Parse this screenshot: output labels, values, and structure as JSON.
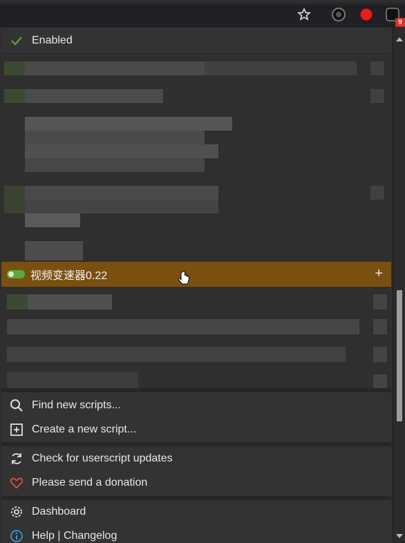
{
  "menu": {
    "enabled_label": "Enabled",
    "active_script": {
      "name": "视频变速器0.22",
      "add_label": "+"
    },
    "items": [
      {
        "label": "Find new scripts...",
        "icon": "search-icon"
      },
      {
        "label": "Create a new script...",
        "icon": "plus-square-icon"
      },
      {
        "label": "Check for userscript updates",
        "icon": "refresh-icon"
      },
      {
        "label": "Please send a donation",
        "icon": "heart-icon"
      },
      {
        "label": "Dashboard",
        "icon": "gear-icon"
      },
      {
        "label": "Help | Changelog",
        "icon": "info-icon"
      }
    ]
  },
  "toolbar": {
    "extension_badge": "9"
  },
  "colors": {
    "background": "#2f2f2f",
    "active_row": "#7a5010",
    "check_green": "#5fa83a",
    "heart_red": "#e05040",
    "info_blue": "#3a9ad9",
    "badge_red": "#d83030"
  }
}
